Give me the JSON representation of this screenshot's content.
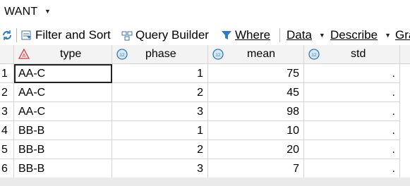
{
  "window": {
    "title": "WANT"
  },
  "toolbar": {
    "filter_sort": "Filter and Sort",
    "query_builder": "Query Builder",
    "where": "Where",
    "data": "Data",
    "describe": "Describe",
    "graph_partial": "Gra"
  },
  "columns": [
    {
      "name": "type",
      "kind": "character",
      "icon": "character-column-icon"
    },
    {
      "name": "phase",
      "kind": "numeric",
      "icon": "numeric-column-icon"
    },
    {
      "name": "mean",
      "kind": "numeric",
      "icon": "numeric-column-icon"
    },
    {
      "name": "std",
      "kind": "numeric",
      "icon": "numeric-column-icon"
    }
  ],
  "rows": [
    {
      "n": "1",
      "type": "AA-C",
      "phase": "1",
      "mean": "75",
      "std": "."
    },
    {
      "n": "2",
      "type": "AA-C",
      "phase": "2",
      "mean": "45",
      "std": "."
    },
    {
      "n": "3",
      "type": "AA-C",
      "phase": "3",
      "mean": "98",
      "std": "."
    },
    {
      "n": "4",
      "type": "BB-B",
      "phase": "1",
      "mean": "10",
      "std": "."
    },
    {
      "n": "5",
      "type": "BB-B",
      "phase": "2",
      "mean": "20",
      "std": "."
    },
    {
      "n": "6",
      "type": "BB-B",
      "phase": "3",
      "mean": "7",
      "std": "."
    }
  ],
  "colors": {
    "numeric_icon": "#2e78c8",
    "character_icon": "#d04040",
    "header_bg": "#f3f3f3",
    "grid_line": "#d4d4d4"
  }
}
